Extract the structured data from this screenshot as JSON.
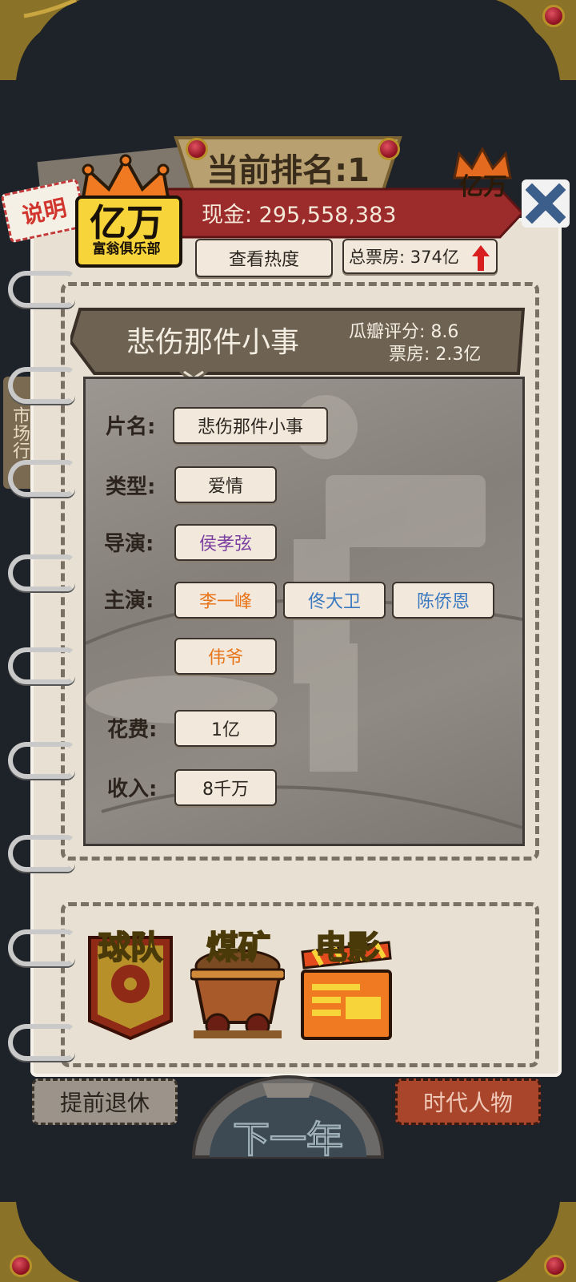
{
  "header": {
    "rank_text": "当前排名:1",
    "cash_text": "现金: 295,558,383",
    "heat_button": "查看热度",
    "box_office_total": "总票房: 374亿",
    "explain_button": "说明",
    "logo_main": "亿万",
    "logo_sub": "富翁俱乐部",
    "logo_small": "亿万",
    "side_tab": "市场行"
  },
  "movie": {
    "title": "悲伤那件小事",
    "rating": "瓜瓣评分: 8.6",
    "box_office": "票房: 2.3亿",
    "fields": {
      "name_label": "片名:",
      "name_value": "悲伤那件小事",
      "genre_label": "类型:",
      "genre_value": "爱情",
      "director_label": "导演:",
      "director_value": "侯孝弦",
      "cast_label": "主演:",
      "cast": [
        "李一峰",
        "佟大卫",
        "陈侨恩",
        "伟爷"
      ],
      "cost_label": "花费:",
      "cost_value": "1亿",
      "income_label": "收入:",
      "income_value": "8千万"
    },
    "colors": {
      "director": "#7b3fa0",
      "cast_orange": "#e8741a",
      "cast_blue": "#3a78c0"
    }
  },
  "categories": [
    {
      "label": "球队",
      "icon": "football-team-banner-icon"
    },
    {
      "label": "煤矿",
      "icon": "coal-minecart-icon"
    },
    {
      "label": "电影",
      "icon": "film-clapperboard-icon"
    }
  ],
  "footer": {
    "retire_button": "提前退休",
    "next_year_button": "下一年",
    "people_button": "时代人物"
  }
}
